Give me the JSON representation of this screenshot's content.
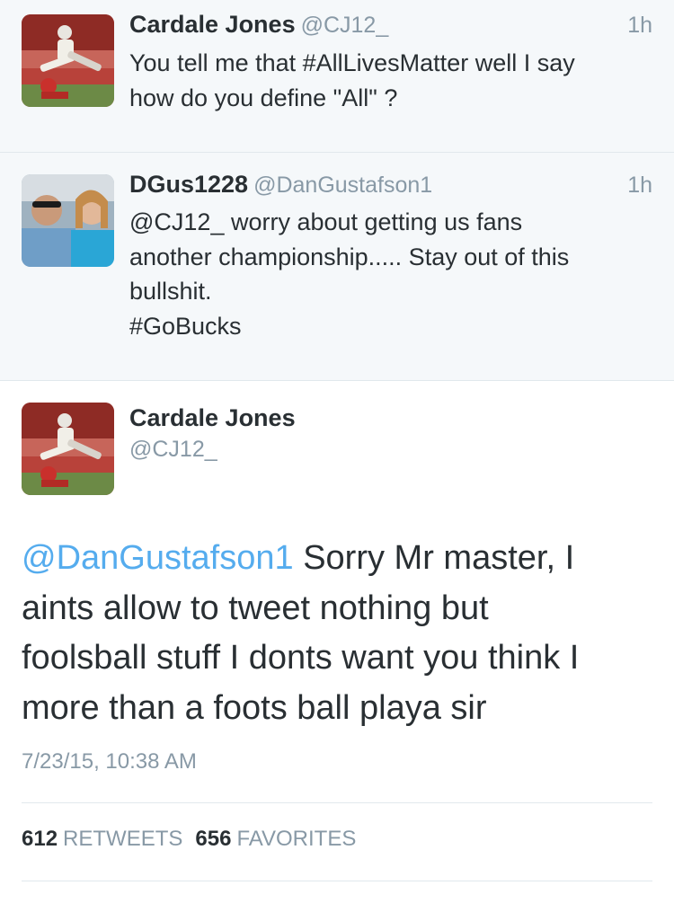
{
  "thread": [
    {
      "avatar": "football-player-photo",
      "name": "Cardale Jones",
      "handle": "@CJ12_",
      "time": "1h",
      "lines": [
        "You tell me that #AllLivesMatter well I say",
        "how do you define \"All\" ?"
      ]
    },
    {
      "avatar": "selfie-photo",
      "name": "DGus1228",
      "handle": "@DanGustafson1",
      "time": "1h",
      "lines": [
        "@CJ12_ worry about getting us fans",
        "another championship..... Stay out of this",
        "bullshit.",
        "#GoBucks"
      ]
    }
  ],
  "focused": {
    "avatar": "football-player-photo",
    "name": "Cardale Jones",
    "handle": "@CJ12_",
    "mention": "@DanGustafson1",
    "line1_rest": " Sorry Mr master, I",
    "lines": [
      "aints allow to tweet nothing but",
      "foolsball stuff I donts want you think I",
      "more than a foots ball playa sir"
    ],
    "timestamp": "7/23/15, 10:38 AM",
    "retweets_count": "612",
    "retweets_label": "RETWEETS",
    "favorites_count": "656",
    "favorites_label": "FAVORITES"
  },
  "colors": {
    "link": "#55acee",
    "muted": "#8899a6",
    "thread_bg": "#f5f8fa"
  }
}
